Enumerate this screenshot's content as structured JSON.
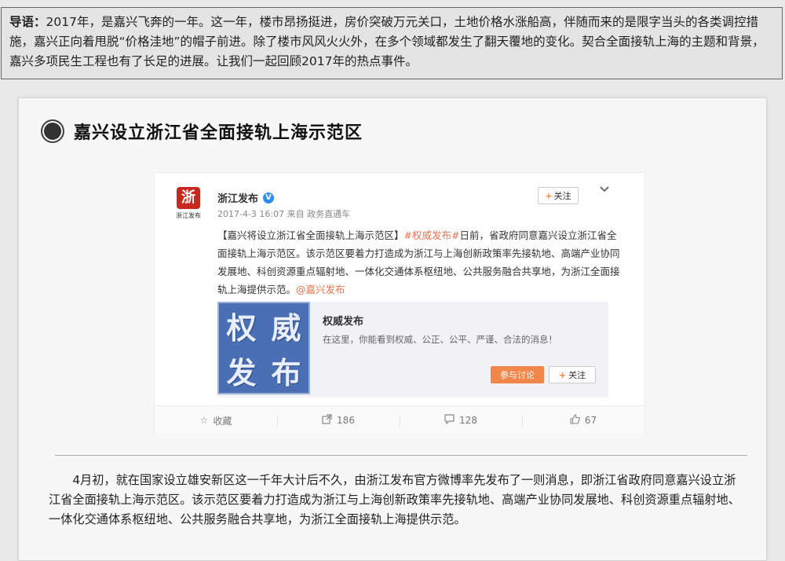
{
  "intro": {
    "label": "导语：",
    "text": "2017年，是嘉兴飞奔的一年。这一年，楼市昂扬挺进，房价突破万元关口，土地价格水涨船高，伴随而来的是限字当头的各类调控措施，嘉兴正向着甩脱“价格洼地”的帽子前进。除了楼市风风火火外，在多个领域都发生了翻天覆地的变化。契合全面接轨上海的主题和背景，嘉兴多项民生工程也有了长足的进展。让我们一起回顾2017年的热点事件。"
  },
  "section": {
    "title": "嘉兴设立浙江省全面接轨上海示范区"
  },
  "weibo": {
    "avatar_char": "浙",
    "avatar_caption": "浙江发布",
    "account_name": "浙江发布",
    "verified_mark": "V",
    "meta": "2017-4-3 16:07 来自 政务直通车",
    "follow_label": "关注",
    "follow_plus": "+",
    "menu_icon": "chevron-down-icon",
    "text_prefix": "【嘉兴将设立浙江省全面接轨上海示范区】",
    "hashtag": "#权威发布#",
    "text_body": "日前，省政府同意嘉兴设立浙江省全面接轨上海示范区。该示范区要着力打造成为浙江与上海创新政策率先接轨地、高端产业协同发展地、科创资源重点辐射地、一体化交通体系枢纽地、公共服务融合共享地，为浙江全面接轨上海提供示范。",
    "mention": "@嘉兴发布",
    "share": {
      "thumb_chars": [
        "权",
        "威",
        "发",
        "布"
      ],
      "title": "权威发布",
      "description": "在这里，你能看到权威、公正、公平、严谨、合法的消息！",
      "join_label": "参与讨论",
      "follow_label": "关注",
      "follow_plus": "+"
    },
    "actions": {
      "collect": "收藏",
      "repost_count": "186",
      "comment_count": "128",
      "like_count": "67"
    }
  },
  "article": {
    "paragraph": "4月初，就在国家设立雄安新区这一千年大计后不久，由浙江发布官方微博率先发布了一则消息，即浙江省政府同意嘉兴设立浙江省全面接轨上海示范区。该示范区要着力打造成为浙江与上海创新政策率先接轨地、高端产业协同发展地、科创资源重点辐射地、一体化交通体系枢纽地、公共服务融合共享地，为浙江全面接轨上海提供示范。"
  },
  "colors": {
    "accent_orange": "#f0864a",
    "link_orange": "#eb7350",
    "verified_blue": "#2d8ff0",
    "thumb_blue": "#4a6fb5"
  }
}
